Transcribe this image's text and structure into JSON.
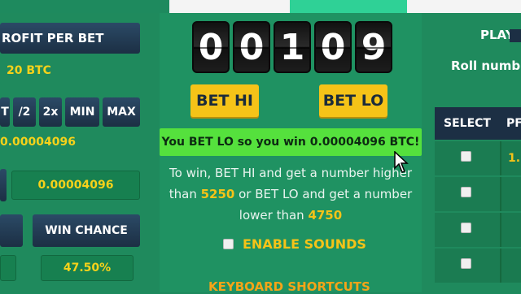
{
  "left_panel": {
    "profit_per_bet_label": "ROFIT PER BET",
    "profit_value": "20 BTC",
    "multiplier_buttons": [
      "T",
      "/2",
      "2x",
      "MIN",
      "MAX"
    ],
    "bet_amount": "0.00004096",
    "payout_value": "0.00004096",
    "win_chance_label": "WIN CHANCE",
    "win_chance_value": "47.50%"
  },
  "center": {
    "roll_digits": [
      "0",
      "0",
      "1",
      "0",
      "9"
    ],
    "bet_hi_label": "BET HI",
    "bet_lo_label": "BET LO",
    "result_message": "You BET LO so you win 0.00004096 BTC!",
    "info": {
      "line1": "To win, BET HI and get a number higher",
      "line2_prefix": "than ",
      "hi_threshold": "5250",
      "line2_suffix": " or BET LO and get a number",
      "line3_prefix": "lower than ",
      "lo_threshold": "4750"
    },
    "enable_sounds_label": "ENABLE SOUNDS",
    "keyboard_shortcuts_label": "KEYBOARD SHORTCUTS"
  },
  "right_panel": {
    "play_label": "PLAY",
    "roll_number_label": "Roll numb",
    "select_header": "SELECT",
    "second_header": "PF",
    "row_values": [
      "1.",
      "",
      "",
      ""
    ]
  },
  "colors": {
    "accent_yellow": "#f5c318",
    "win_green": "#55e13d",
    "panel_green": "#1f8a5d",
    "dark_navy": "#1c2f44"
  }
}
